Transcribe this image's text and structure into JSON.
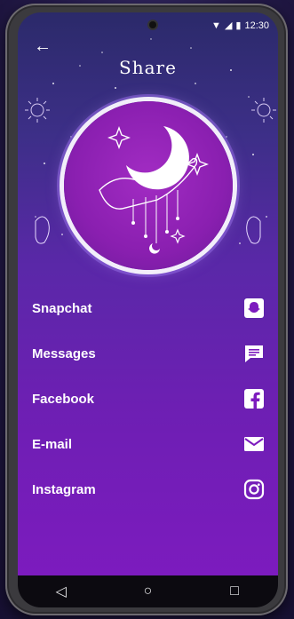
{
  "status": {
    "time": "12:30"
  },
  "header": {
    "back_symbol": "←",
    "title": "Share"
  },
  "share_options": [
    {
      "label": "Snapchat",
      "icon": "snapchat-icon"
    },
    {
      "label": "Messages",
      "icon": "message-icon"
    },
    {
      "label": "Facebook",
      "icon": "facebook-icon"
    },
    {
      "label": "E-mail",
      "icon": "email-icon"
    },
    {
      "label": "Instagram",
      "icon": "instagram-icon"
    }
  ],
  "nav": {
    "back": "◁",
    "home": "○",
    "recents": "□"
  },
  "colors": {
    "accent": "#7c1bbe",
    "text": "#ffffff"
  }
}
